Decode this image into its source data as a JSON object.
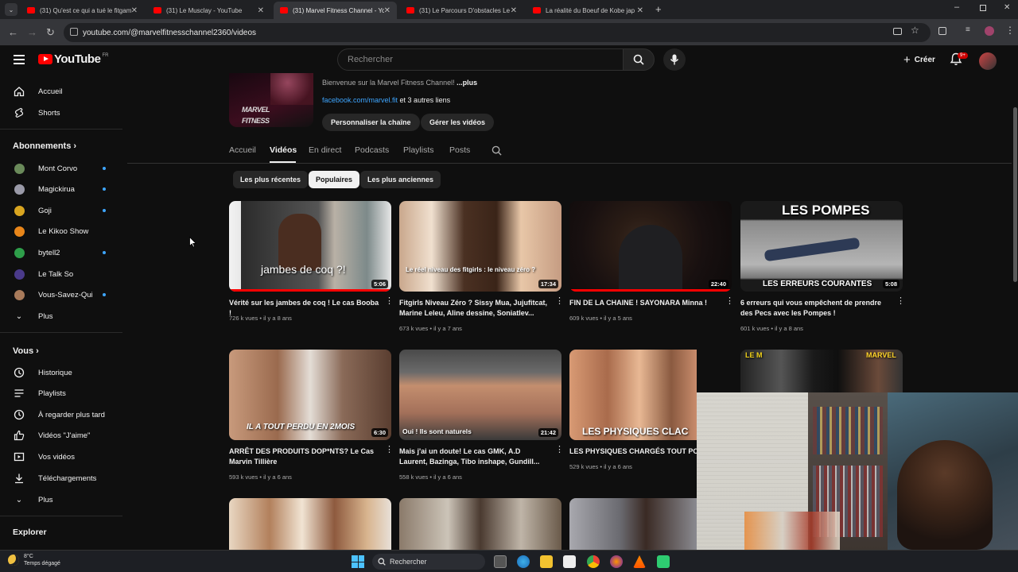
{
  "browser": {
    "tabs": [
      {
        "title": "(31) Qu'est ce qui a tué le fitgam",
        "active": false
      },
      {
        "title": "(31) Le Musclay - YouTube",
        "active": false
      },
      {
        "title": "(31) Marvel Fitness Channel - Yo",
        "active": true
      },
      {
        "title": "(31) Le Parcours D'obstacles Le",
        "active": false
      },
      {
        "title": "La réalité du Boeuf de Kobe jap",
        "active": false
      }
    ],
    "url": "youtube.com/@marvelfitnesschannel2360/videos",
    "close_glyph": "✕",
    "new_tab_glyph": "+"
  },
  "header": {
    "logo_text": "YouTube",
    "country": "FR",
    "search_placeholder": "Rechercher",
    "create_label": "Créer",
    "notif_badge": "9+"
  },
  "sidebar": {
    "main": [
      {
        "label": "Accueil",
        "icon": "home-icon"
      },
      {
        "label": "Shorts",
        "icon": "shorts-icon"
      }
    ],
    "subs_title": "Abonnements",
    "subs": [
      {
        "label": "Mont Corvo",
        "color": "#6a8a5a",
        "dot": true
      },
      {
        "label": "Magickirua",
        "color": "#9a9aa8",
        "dot": true
      },
      {
        "label": "Goji",
        "color": "#d9a520",
        "dot": true
      },
      {
        "label": "Le Kikoo Show",
        "color": "#e8861a",
        "dot": false
      },
      {
        "label": "bytell2",
        "color": "#2e9e4a",
        "dot": true
      },
      {
        "label": "Le Talk So",
        "color": "#4a3a8a",
        "dot": false
      },
      {
        "label": "Vous-Savez-Qui",
        "color": "#a87a5a",
        "dot": true
      }
    ],
    "subs_more": "Plus",
    "you_title": "Vous",
    "you": [
      {
        "label": "Historique",
        "icon": "history-icon"
      },
      {
        "label": "Playlists",
        "icon": "playlists-icon"
      },
      {
        "label": "À regarder plus tard",
        "icon": "watch-later-icon"
      },
      {
        "label": "Vidéos \"J'aime\"",
        "icon": "like-icon"
      },
      {
        "label": "Vos vidéos",
        "icon": "your-videos-icon"
      },
      {
        "label": "Téléchargements",
        "icon": "download-icon"
      }
    ],
    "you_more": "Plus",
    "explore_title": "Explorer"
  },
  "channel": {
    "brand": "MARVEL",
    "brand_sub": "FITNESS",
    "description": "Bienvenue sur la Marvel Fitness Channel!",
    "more": " ...plus",
    "link": "facebook.com/marvel.fit",
    "link_suffix": " et 3 autres liens",
    "customize_label": "Personnaliser la chaîne",
    "manage_label": "Gérer les vidéos",
    "tabs": [
      "Accueil",
      "Vidéos",
      "En direct",
      "Podcasts",
      "Playlists",
      "Posts"
    ],
    "active_tab": "Vidéos",
    "chips": [
      "Les plus récentes",
      "Populaires",
      "Les plus anciennes"
    ],
    "active_chip": "Populaires"
  },
  "videos": [
    {
      "title": "Vérité sur les jambes de coq ! Le cas Booba !",
      "views": "726 k vues",
      "age": "il y a 8 ans",
      "duration": "5:06",
      "overlay": "jambes de coq ?!",
      "progress": 1.0
    },
    {
      "title": "Fitgirls Niveau Zéro ? Sissy Mua, Jujufitcat, Marine Leleu, Aline dessine, Soniatlev...",
      "views": "673 k vues",
      "age": "il y a 7 ans",
      "duration": "17:34",
      "overlay": "Le réel niveau des fitgirls : le niveau zéro ?",
      "progress": 0
    },
    {
      "title": "FIN DE LA CHAINE ! SAYONARA Minna !",
      "views": "609 k vues",
      "age": "il y a 5 ans",
      "duration": "22:40",
      "overlay": "",
      "progress": 1.0
    },
    {
      "title": "6 erreurs qui vous empêchent de prendre des Pecs avec les Pompes !",
      "views": "601 k vues",
      "age": "il y a 8 ans",
      "duration": "5:08",
      "overlay": "LES POMPES",
      "overlay2": "LES ERREURS COURANTES",
      "progress": 0
    },
    {
      "title": "ARRÊT DES PRODUITS DOP*NTS? Le Cas Marvin Tillière",
      "views": "593 k vues",
      "age": "il y a 6 ans",
      "duration": "6:30",
      "overlay": "IL A TOUT PERDU EN 2MOIS",
      "progress": 0
    },
    {
      "title": "Mais j'ai un doute! Le cas GMK, A.D Laurent, Bazinga, Tibo inshape, Gundill...",
      "views": "558 k vues",
      "age": "il y a 6 ans",
      "duration": "21:42",
      "overlay": "Oui ! Ils sont naturels",
      "progress": 0
    },
    {
      "title": "LES PHYSIQUES CHARGÉS TOUT POU",
      "views": "529 k vues",
      "age": "il y a 6 ans",
      "duration": "",
      "overlay": "LES PHYSIQUES CLAC",
      "progress": 0
    },
    {
      "title": "",
      "views": "",
      "age": "",
      "duration": "",
      "overlay": "LE M",
      "overlay2": "MARVEL",
      "progress": 0
    }
  ],
  "taskbar": {
    "temp": "8°C",
    "weather": "Temps dégagé",
    "search": "Rechercher"
  },
  "colors": {
    "background": "#0f0f0f",
    "accent_red": "#ff0000",
    "link_blue": "#3ea6ff",
    "chip_bg": "#272727"
  }
}
